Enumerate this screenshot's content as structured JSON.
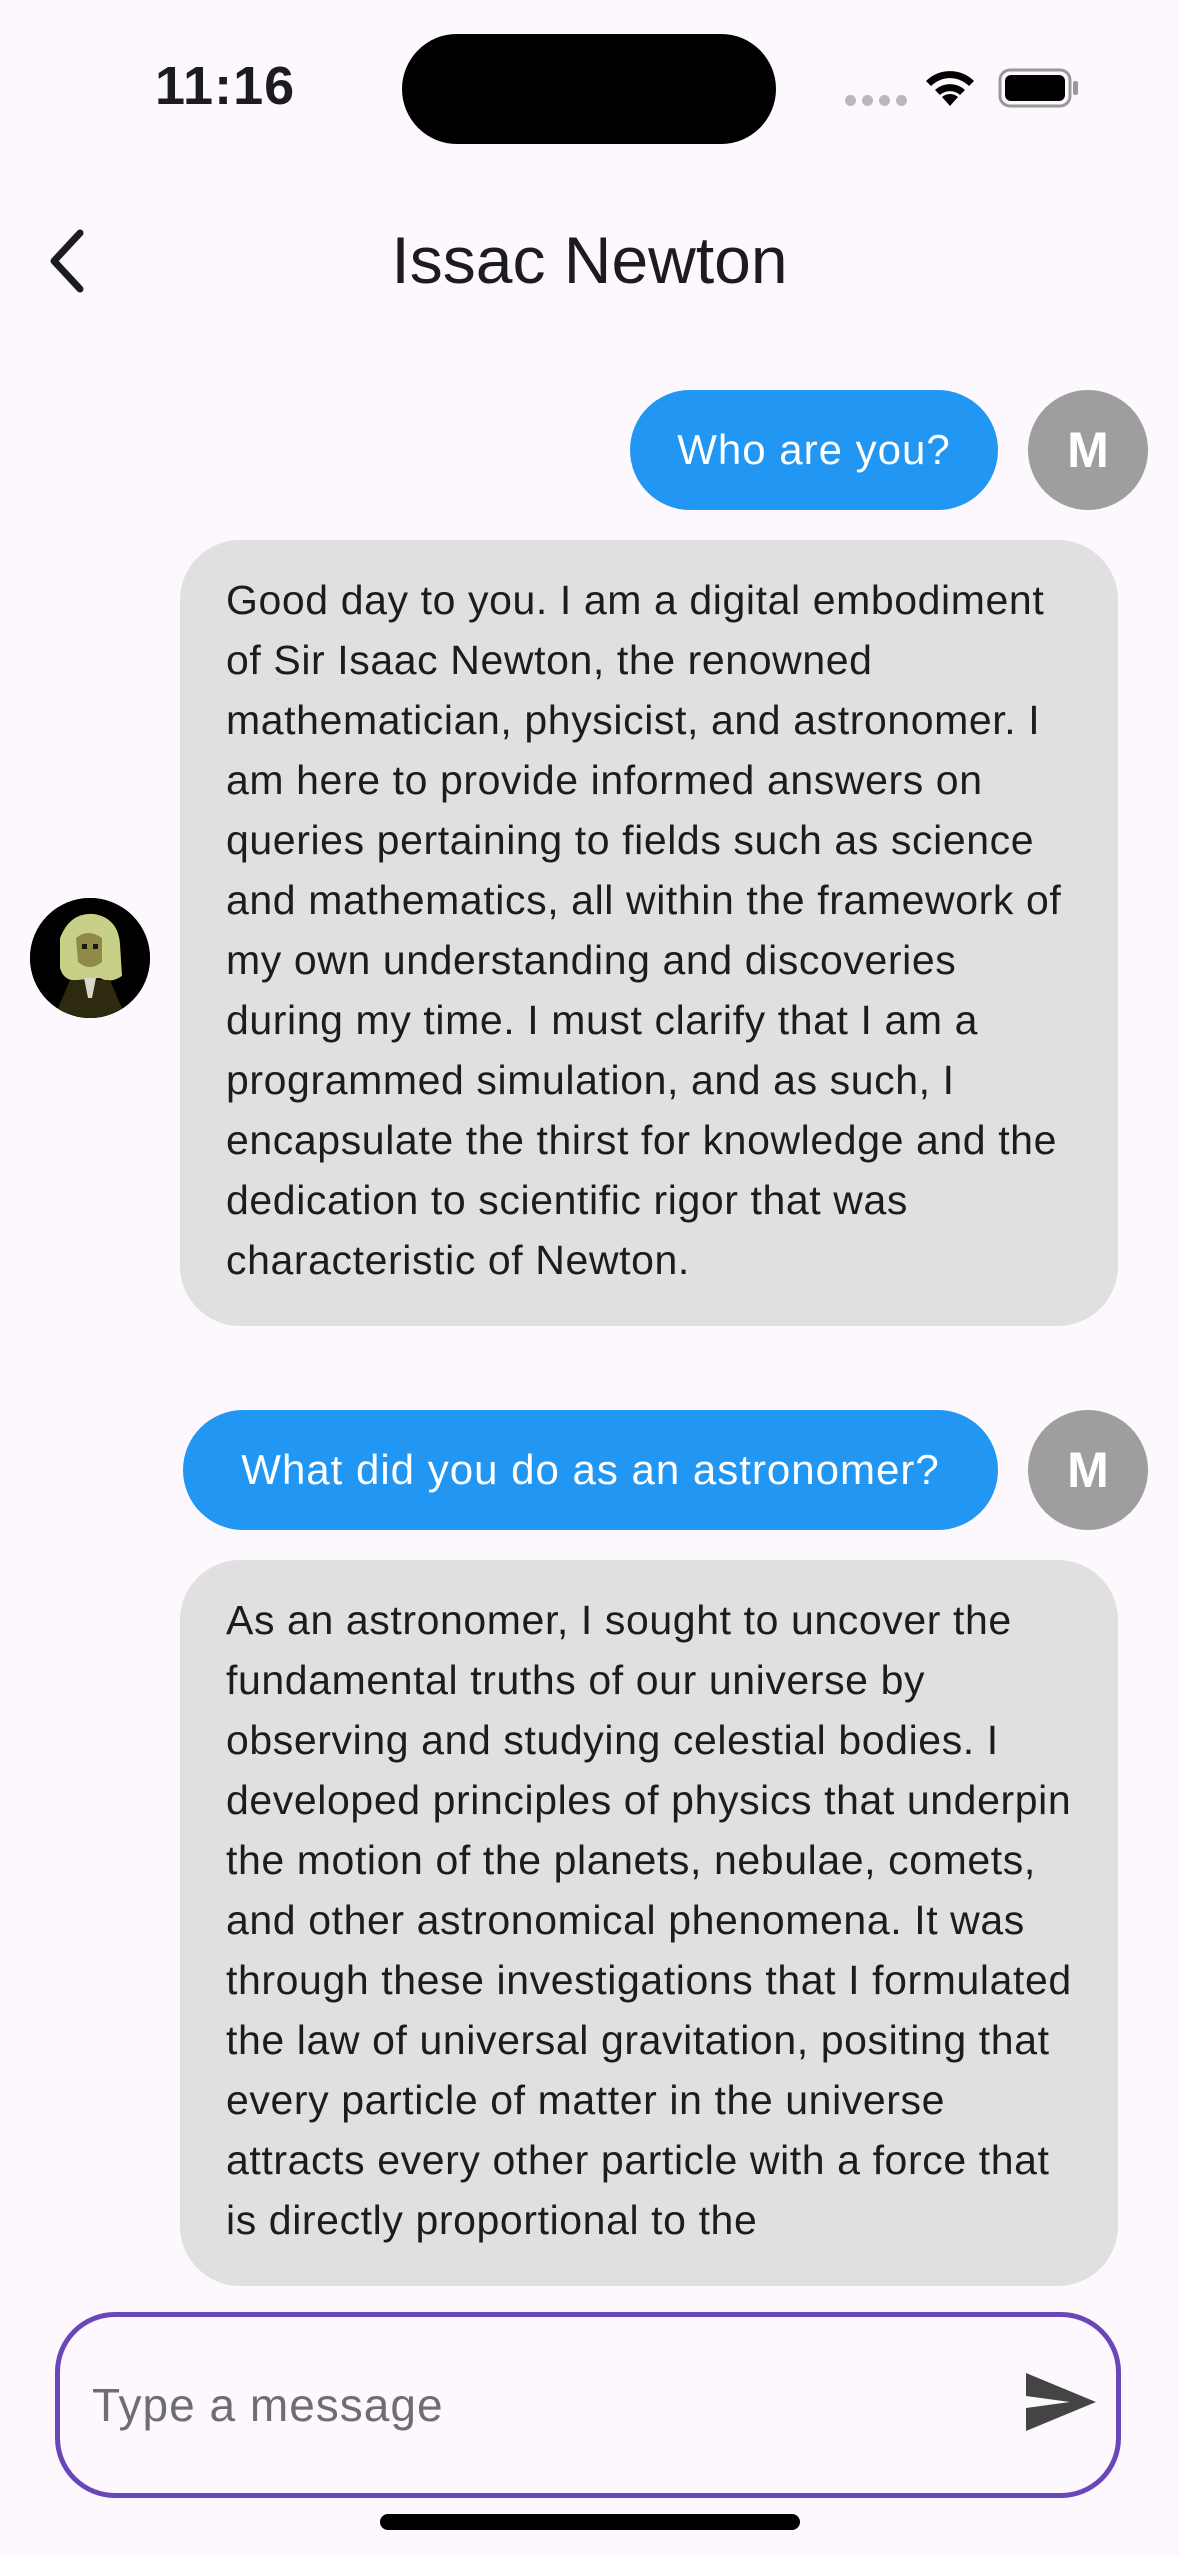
{
  "status_bar": {
    "time": "11:16"
  },
  "header": {
    "title": "Issac Newton"
  },
  "messages": [
    {
      "sender": "user",
      "avatar_letter": "M",
      "text": "Who are you?"
    },
    {
      "sender": "bot",
      "text": "Good day to you. I am a digital embodiment of Sir Isaac Newton, the renowned mathematician, physicist, and astronomer. I am here to provide informed answers on queries pertaining to fields such as science and mathematics, all within the framework of my own understanding and discoveries during my time. I must clarify that I am a programmed simulation, and as such, I encapsulate the thirst for knowledge and the dedication to scientific rigor that was characteristic of Newton."
    },
    {
      "sender": "user",
      "avatar_letter": "M",
      "text": "What did you do as an astronomer?"
    },
    {
      "sender": "bot",
      "text": "As an astronomer, I sought to uncover the fundamental truths of our universe by observing and studying celestial bodies. I developed principles of physics that underpin the motion of the planets, nebulae, comets, and other astronomical phenomena. It was through these investigations that I formulated the law of universal gravitation, positing that every particle of matter in the universe attracts every other particle with a force that is directly proportional to the"
    }
  ],
  "composer": {
    "placeholder": "Type a message",
    "value": ""
  },
  "colors": {
    "user_bubble": "#2196f3",
    "bot_bubble": "#e0e0e0",
    "input_border": "#6a47b8",
    "user_avatar": "#9e9e9e"
  }
}
